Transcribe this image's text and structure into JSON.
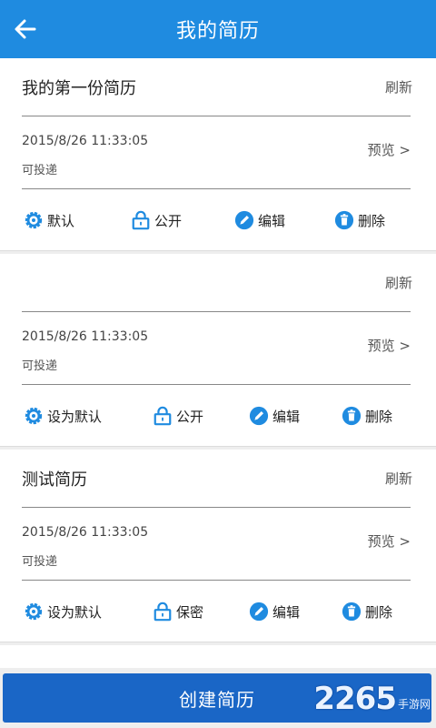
{
  "header": {
    "title": "我的简历",
    "back_icon": "arrow-left-icon"
  },
  "colors": {
    "header_bg": "#1f8be0",
    "button_bg": "#1a66c6",
    "icon_blue": "#1f8be0"
  },
  "resumes": [
    {
      "name": "我的第一份简历",
      "refresh": "刷新",
      "date": "2015/8/26 11:33:05",
      "status": "可投递",
      "preview": "预览 >",
      "actions": {
        "default": "默认",
        "privacy": "公开",
        "edit": "编辑",
        "delete": "删除"
      }
    },
    {
      "name": "",
      "refresh": "刷新",
      "date": "2015/8/26 11:33:05",
      "status": "可投递",
      "preview": "预览 >",
      "actions": {
        "default": "设为默认",
        "privacy": "公开",
        "edit": "编辑",
        "delete": "删除"
      }
    },
    {
      "name": "测试简历",
      "refresh": "刷新",
      "date": "2015/8/26 11:33:05",
      "status": "可投递",
      "preview": "预览 >",
      "actions": {
        "default": "设为默认",
        "privacy": "保密",
        "edit": "编辑",
        "delete": "删除"
      }
    }
  ],
  "create_button": "创建简历",
  "watermark": {
    "number": "2265",
    "site": "手游网"
  }
}
